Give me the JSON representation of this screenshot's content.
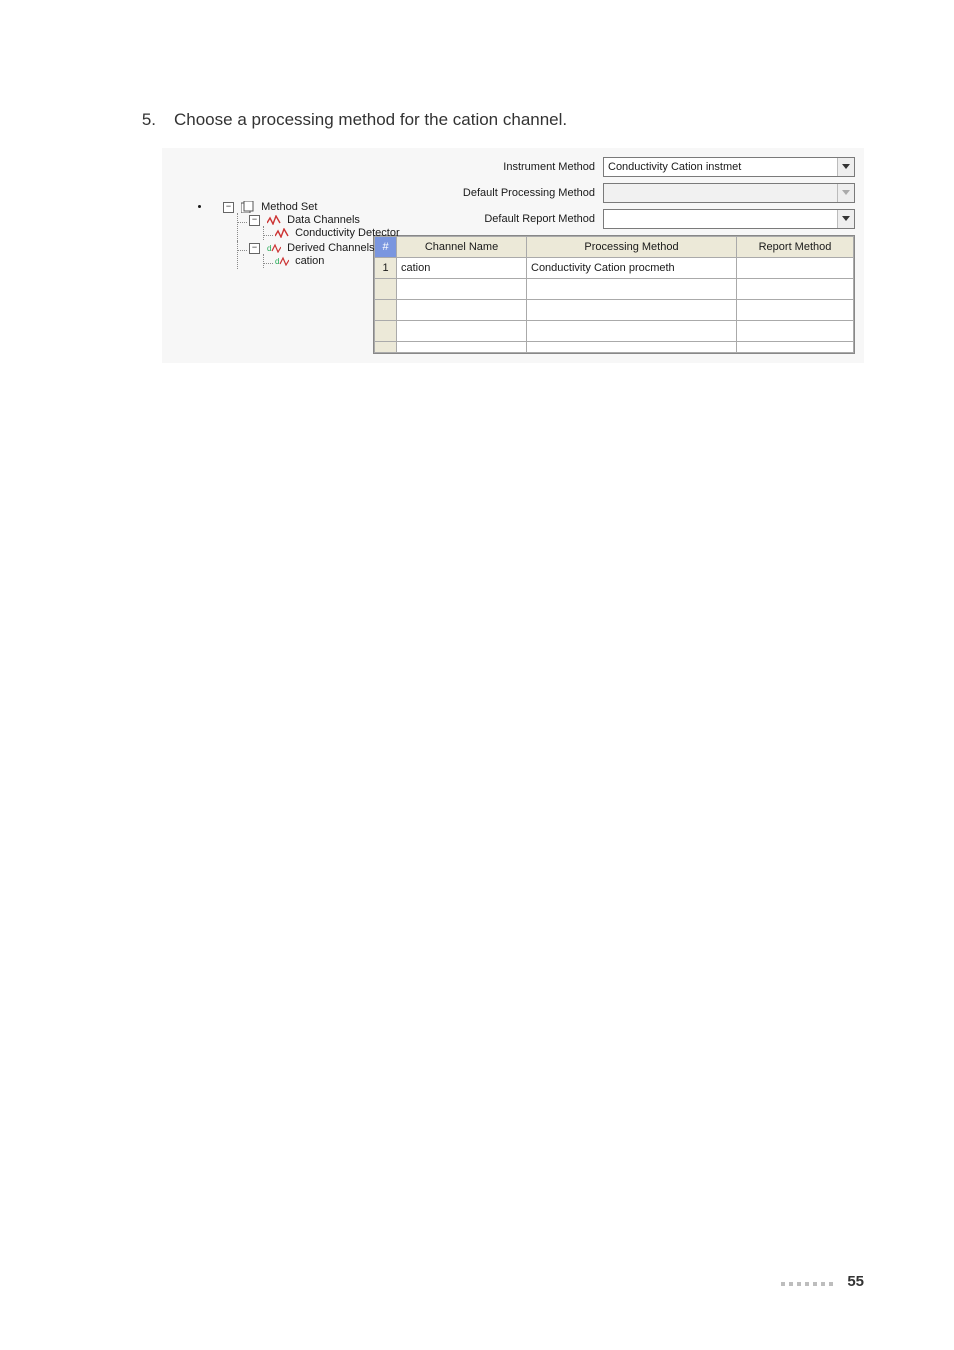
{
  "instruction": {
    "number": "5.",
    "text": "Choose a processing method for the cation channel."
  },
  "tree": {
    "root": "Method Set",
    "data_channels": {
      "label": "Data Channels",
      "children": [
        "Conductivity Detector"
      ]
    },
    "derived_channels": {
      "label": "Derived Channels",
      "children": [
        "cation"
      ]
    }
  },
  "expander_glyph": "−",
  "form": {
    "instrument_method": {
      "label": "Instrument Method",
      "value": "Conductivity Cation instmet"
    },
    "default_processing_method": {
      "label": "Default Processing Method",
      "value": ""
    },
    "default_report_method": {
      "label": "Default Report Method",
      "value": ""
    }
  },
  "grid": {
    "corner": "#",
    "headers": [
      "Channel Name",
      "Processing Method",
      "Report Method"
    ],
    "rows": [
      {
        "n": "1",
        "channel": "cation",
        "processing": "Conductivity Cation procmeth",
        "report": ""
      },
      {
        "n": "",
        "channel": "",
        "processing": "",
        "report": ""
      },
      {
        "n": "",
        "channel": "",
        "processing": "",
        "report": ""
      },
      {
        "n": "",
        "channel": "",
        "processing": "",
        "report": ""
      },
      {
        "n": "",
        "channel": "",
        "processing": "",
        "report": ""
      }
    ]
  },
  "footer": {
    "page": "55"
  }
}
